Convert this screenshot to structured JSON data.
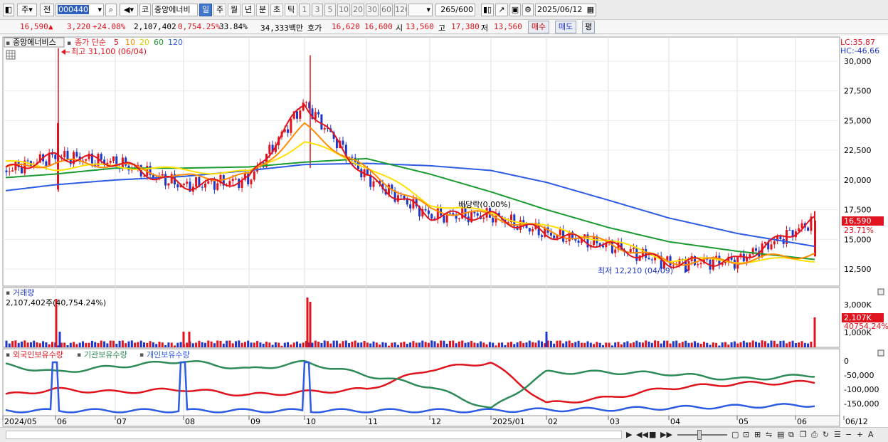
{
  "toolbar": {
    "market_buttons": [
      "주",
      "전"
    ],
    "code_value": "000440",
    "code_button": "코",
    "stock_name": "중앙에너비",
    "periods": [
      "일",
      "주",
      "월",
      "년",
      "분",
      "초",
      "틱"
    ],
    "active_period": "일",
    "intervals": [
      "1",
      "3",
      "5",
      "10",
      "20",
      "30",
      "60",
      "120"
    ],
    "count_value": "265",
    "count_max": "/600",
    "date_value": "2025/06/12"
  },
  "quote": {
    "price": "16,590",
    "change_arrow": "▲",
    "change": "3,220",
    "change_pct": "+24.08%",
    "volume": "2,107,402",
    "turnover_pct": "0,754.25%",
    "turnover2": "33.84%",
    "amount": "34,333백만",
    "ask_label": "호가",
    "ask": "16,620",
    "bid": "16,600",
    "open_label": "시",
    "open": "13,560",
    "high_label": "고",
    "high": "17,380",
    "low_label": "저",
    "low": "13,560",
    "buy_button": "매수",
    "sell_button": "매도",
    "eval_button": "평"
  },
  "price_panel": {
    "stock_tag": "중앙에너비스",
    "ma_label": "종가 단순",
    "ma_periods": [
      "5",
      "10",
      "20",
      "60",
      "120"
    ],
    "high_annotation": "최고 31,100 (06/04)",
    "low_annotation": "최저 12,210 (04/09)",
    "dividend_annotation": "배당락(0.00%)",
    "lc": "LC:35.87",
    "hc": "HC:-46.66",
    "current_price_tag": "16,590",
    "current_pct_tag": "23.71%",
    "y_ticks": [
      "30,000",
      "27,500",
      "25,000",
      "22,500",
      "20,000",
      "17,500",
      "15,000",
      "12,500"
    ]
  },
  "volume_panel": {
    "title": "거래량",
    "info": "2,107,402주(40,754.24%)",
    "y_ticks": [
      "3,000K",
      "2,000K",
      "1,000K"
    ],
    "current_tag": "2,107K",
    "current_pct": "40754.24%"
  },
  "holding_panel": {
    "legend": [
      "외국인보유수량",
      "기관보유수량",
      "개인보유수량"
    ],
    "y_ticks": [
      "0",
      "-50,000",
      "-100,000",
      "-150,000"
    ]
  },
  "x_axis": {
    "labels": [
      "2024/05",
      "06",
      "07",
      "08",
      "09",
      "10",
      "11",
      "12",
      "2025/01",
      "02",
      "03",
      "04",
      "05",
      "06",
      "06/12"
    ]
  },
  "colors": {
    "up": "#e0141e",
    "down": "#1f37c8",
    "ma5": "#e0141e",
    "ma10": "#ff8c00",
    "ma20": "#ffe000",
    "ma60": "#1a9b32",
    "ma120": "#2d5be3",
    "foreign": "#e0141e",
    "institution": "#2e8b57",
    "individual": "#2d5be3",
    "accent": "#3f76c9"
  },
  "chart_data": [
    {
      "type": "line",
      "title": "중앙에너비스 종가 단순 이동평균",
      "x": [
        "2024/05",
        "06",
        "07",
        "08",
        "09",
        "10",
        "11",
        "12",
        "2025/01",
        "02",
        "03",
        "04",
        "05",
        "06/12"
      ],
      "series": [
        {
          "name": "5",
          "values": [
            20800,
            22000,
            21500,
            19500,
            20000,
            26500,
            20200,
            17000,
            17000,
            15500,
            14500,
            13000,
            13200,
            16590
          ]
        },
        {
          "name": "10",
          "values": [
            20900,
            21500,
            21300,
            20200,
            20300,
            24500,
            20800,
            17500,
            17000,
            15700,
            14700,
            13100,
            13200,
            13800
          ]
        },
        {
          "name": "20",
          "values": [
            21500,
            21000,
            21200,
            20800,
            20600,
            23200,
            21200,
            18000,
            17200,
            16000,
            14900,
            13300,
            13200,
            13300
          ]
        },
        {
          "name": "60",
          "values": [
            20200,
            20500,
            21000,
            21000,
            21100,
            21500,
            21800,
            20500,
            19000,
            17500,
            16000,
            14800,
            14000,
            13300
          ]
        },
        {
          "name": "120",
          "values": [
            19100,
            19600,
            20000,
            20300,
            20800,
            21300,
            21400,
            21200,
            20800,
            19800,
            18300,
            16800,
            15500,
            14400
          ]
        }
      ],
      "ylim": [
        12000,
        31500
      ],
      "annotations": [
        "최고 31,100 (06/04)",
        "최저 12,210 (04/09)",
        "배당락(0.00%)"
      ]
    },
    {
      "type": "bar",
      "title": "거래량",
      "categories": [
        "2024/05",
        "06/04",
        "08",
        "10",
        "2025/02",
        "06/12"
      ],
      "values": [
        150,
        3400,
        1100,
        3500,
        1100,
        2107
      ],
      "ylabel": "K"
    },
    {
      "type": "line",
      "title": "보유수량",
      "series": [
        {
          "name": "외국인보유수량",
          "values": [
            -120000,
            -100000,
            -110000,
            -100000,
            -120000,
            -110000,
            -100000,
            -30000,
            -5000,
            -150000,
            -130000,
            -95000,
            -80000,
            -75000
          ]
        },
        {
          "name": "기관보유수량",
          "values": [
            -15000,
            -40000,
            -20000,
            0,
            -30000,
            -5000,
            -50000,
            -90000,
            -170000,
            -40000,
            -40000,
            -45000,
            -65000,
            -50000
          ]
        },
        {
          "name": "개인보유수량",
          "values": [
            -175000,
            -175000,
            -175000,
            -175000,
            -175000,
            -175000,
            -175000,
            -175000,
            -175000,
            -172000,
            -170000,
            -165000,
            -160000,
            -155000
          ]
        }
      ],
      "ylim": [
        -180000,
        10000
      ]
    }
  ]
}
